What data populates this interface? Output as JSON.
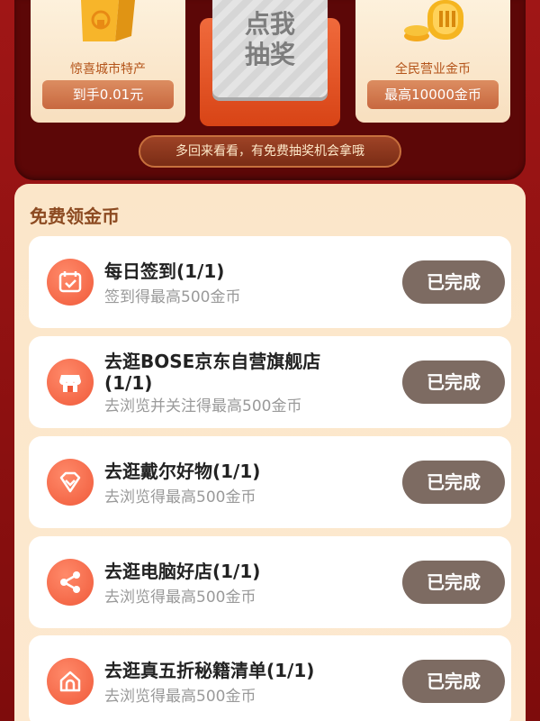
{
  "prizes": {
    "left": {
      "title": "惊喜城市特产",
      "pill": "到手0.01元",
      "icon": "gift-box-icon"
    },
    "right": {
      "title": "全民营业金币",
      "pill": "最高10000金币",
      "icon": "gold-coins-icon"
    }
  },
  "draw_button": {
    "line1": "点我",
    "line2": "抽奖"
  },
  "notice": "多回来看看，有免费抽奖机会拿哦",
  "section_title": "免费领金币",
  "tasks": [
    {
      "title": "每日签到(1/1)",
      "subtitle": "签到得最高500金币",
      "button": "已完成",
      "icon": "calendar-check-icon"
    },
    {
      "title": "去逛BOSE京东自营旗舰店(1/1)",
      "subtitle": "去浏览并关注得最高500金币",
      "button": "已完成",
      "icon": "store-icon"
    },
    {
      "title": "去逛戴尔好物(1/1)",
      "subtitle": "去浏览得最高500金币",
      "button": "已完成",
      "icon": "gem-icon"
    },
    {
      "title": "去逛电脑好店(1/1)",
      "subtitle": "去浏览得最高500金币",
      "button": "已完成",
      "icon": "share-icon"
    },
    {
      "title": "去逛真五折秘籍清单(1/1)",
      "subtitle": "去浏览得最高500金币",
      "button": "已完成",
      "icon": "home-icon"
    }
  ],
  "colors": {
    "background": "#8e1212",
    "panel_dark": "#5c0707",
    "task_button": "#7d6b62",
    "icon_orange": "#f05a3a",
    "section_title": "#8c4a21"
  }
}
